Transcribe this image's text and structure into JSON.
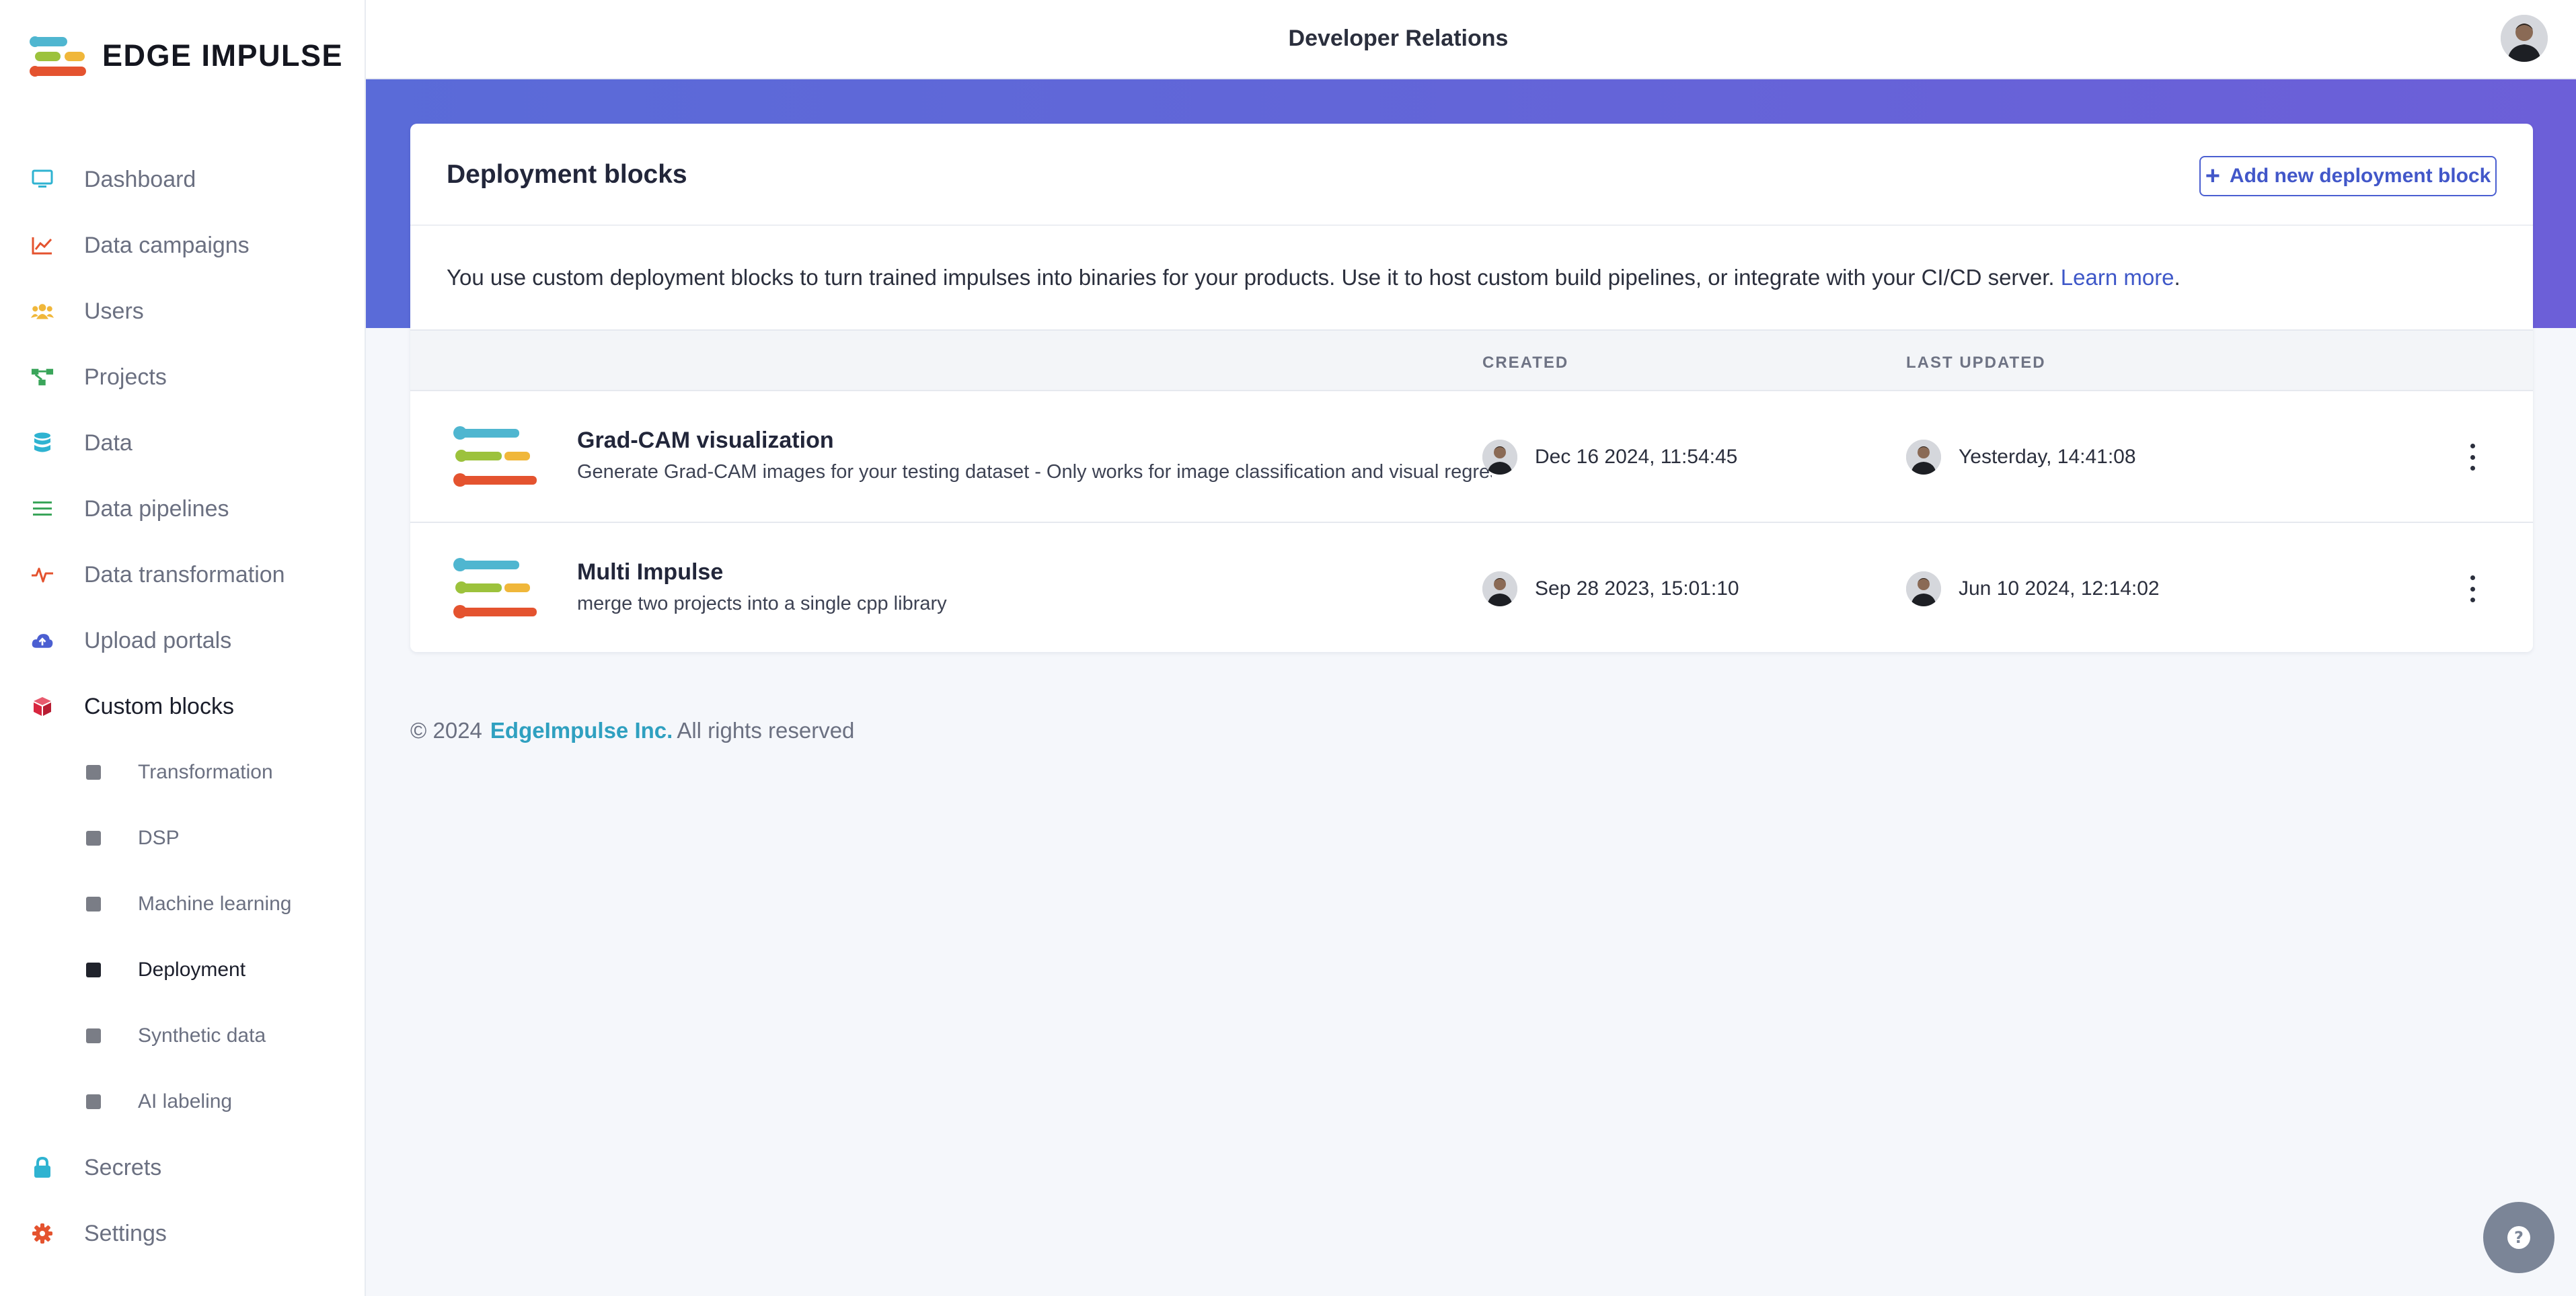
{
  "brand": {
    "name": "EDGE IMPULSE"
  },
  "header": {
    "org_title": "Developer Relations"
  },
  "sidebar": {
    "items": [
      {
        "label": "Dashboard",
        "icon": "monitor-icon",
        "color": "#2fb3d1"
      },
      {
        "label": "Data campaigns",
        "icon": "chart-line-icon",
        "color": "#e4532f"
      },
      {
        "label": "Users",
        "icon": "users-icon",
        "color": "#f0b73a"
      },
      {
        "label": "Projects",
        "icon": "project-diagram-icon",
        "color": "#3aa55a"
      },
      {
        "label": "Data",
        "icon": "database-icon",
        "color": "#2fb3d1"
      },
      {
        "label": "Data pipelines",
        "icon": "list-icon",
        "color": "#3aa55a"
      },
      {
        "label": "Data transformation",
        "icon": "pulse-icon",
        "color": "#e4532f"
      },
      {
        "label": "Upload portals",
        "icon": "cloud-upload-icon",
        "color": "#4b5fd1"
      },
      {
        "label": "Custom blocks",
        "icon": "cube-icon",
        "color": "#d8263f"
      },
      {
        "label": "Secrets",
        "icon": "lock-icon",
        "color": "#2fb3d1"
      },
      {
        "label": "Settings",
        "icon": "gear-icon",
        "color": "#e4532f"
      }
    ],
    "sub_items": [
      {
        "label": "Transformation"
      },
      {
        "label": "DSP"
      },
      {
        "label": "Machine learning"
      },
      {
        "label": "Deployment"
      },
      {
        "label": "Synthetic data"
      },
      {
        "label": "AI labeling"
      }
    ]
  },
  "card": {
    "title": "Deployment blocks",
    "add_button_label": "Add new deployment block",
    "intro_text": "You use custom deployment blocks to turn trained impulses into binaries for your products. Use it to host custom build pipelines, or integrate with your CI/CD server. ",
    "learn_more": "Learn more",
    "intro_end": "."
  },
  "table": {
    "columns": {
      "created": "CREATED",
      "last_updated": "LAST UPDATED"
    },
    "rows": [
      {
        "name": "Grad-CAM visualization",
        "description": "Generate Grad-CAM images for your testing dataset - Only works for image classification and visual regression models",
        "created": "Dec 16 2024, 11:54:45",
        "last_updated": "Yesterday, 14:41:08"
      },
      {
        "name": "Multi Impulse",
        "description": "merge two projects into a single cpp library",
        "created": "Sep 28 2023, 15:01:10",
        "last_updated": "Jun 10 2024, 12:14:02"
      }
    ]
  },
  "footer": {
    "copyright": "© 2024",
    "company": "EdgeImpulse Inc.",
    "rights": "All rights reserved"
  },
  "colors": {
    "accent": "#4b5fd1",
    "banner_start": "#5a6bd8",
    "banner_end": "#6c5fd8",
    "link": "#3e57c8"
  }
}
